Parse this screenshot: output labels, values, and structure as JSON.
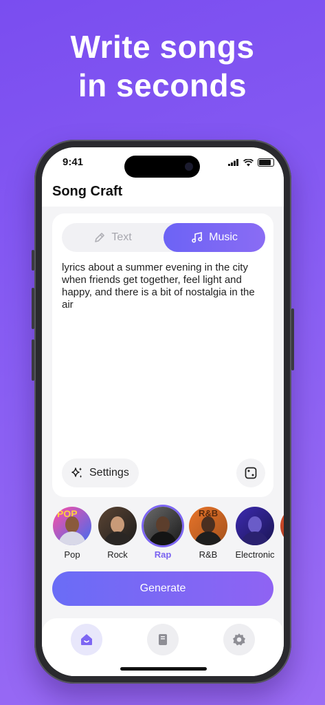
{
  "headline": [
    "Write songs",
    "in seconds"
  ],
  "status": {
    "time": "9:41"
  },
  "app": {
    "title": "Song Craft"
  },
  "mode_tabs": {
    "text": "Text",
    "music": "Music",
    "active": "Music"
  },
  "prompt_text": "lyrics about a summer evening in the city when friends get together, feel light and happy, and there is a bit of nostalgia in the air",
  "settings_label": "Settings",
  "genres": [
    {
      "label": "Pop",
      "selected": false,
      "colors": [
        "#ff4fa3",
        "#3f6cf0"
      ],
      "avatar_text": "POP"
    },
    {
      "label": "Rock",
      "selected": false,
      "colors": [
        "#5b4433",
        "#1d1d1d"
      ]
    },
    {
      "label": "Rap",
      "selected": true,
      "colors": [
        "#6a6a6a",
        "#1a1a1a"
      ]
    },
    {
      "label": "R&B",
      "selected": false,
      "colors": [
        "#e8742a",
        "#a5521c"
      ],
      "avatar_text": "R&B"
    },
    {
      "label": "Electronic",
      "selected": false,
      "colors": [
        "#3d2ab0",
        "#1b1654"
      ]
    }
  ],
  "generate_label": "Generate",
  "tabs": [
    {
      "icon": "home-icon",
      "active": true
    },
    {
      "icon": "book-icon",
      "active": false
    },
    {
      "icon": "gear-icon",
      "active": false
    }
  ],
  "colors": {
    "accent": "#7d66f3",
    "background_top": "#7a4df0",
    "background_bottom": "#9b6cf4"
  }
}
